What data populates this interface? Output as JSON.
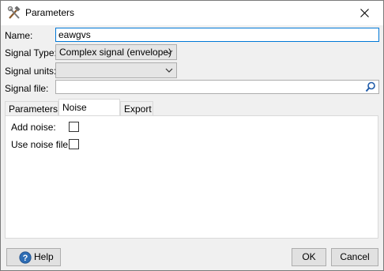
{
  "window": {
    "title": "Parameters"
  },
  "form": {
    "name_label": "Name:",
    "name_value": "eawgvs",
    "signal_type_label": "Signal Type:",
    "signal_type_value": "Complex signal (envelope)",
    "signal_units_label": "Signal units:",
    "signal_units_value": "",
    "signal_file_label": "Signal file:",
    "signal_file_value": ""
  },
  "tabs": [
    {
      "label": "Parameters"
    },
    {
      "label": "Noise params"
    },
    {
      "label": "Export"
    }
  ],
  "active_tab": "Noise params",
  "noise_params": {
    "add_noise_label": "Add noise:",
    "add_noise_checked": false,
    "use_noise_file_label": "Use noise file:",
    "use_noise_file_checked": false
  },
  "buttons": {
    "help": "Help",
    "ok": "OK",
    "cancel": "Cancel"
  },
  "colors": {
    "focus_border": "#0078d7",
    "help_icon": "#2e6db4",
    "search_icon": "#1e5aa8"
  },
  "icons": {
    "title": "wrench-hammer-icon",
    "close": "close-icon",
    "dropdown": "chevron-down-icon",
    "search": "search-icon",
    "help": "help-icon"
  }
}
